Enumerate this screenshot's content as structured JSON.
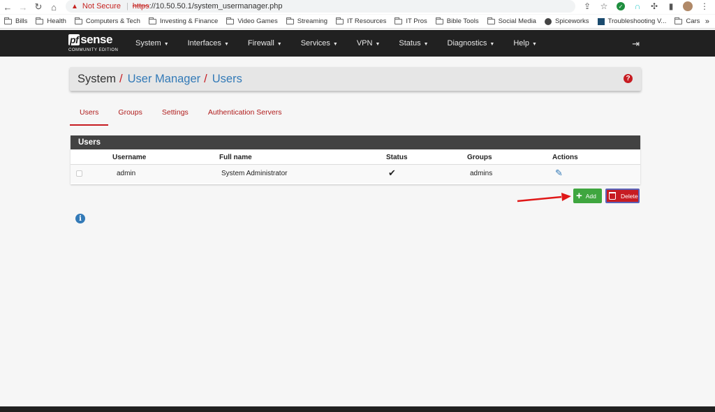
{
  "browser": {
    "not_secure": "Not Secure",
    "url_scheme": "https",
    "url_rest": "://10.50.50.1/system_usermanager.php",
    "bookmarks": [
      {
        "label": "Bills",
        "icon": "folder-icon"
      },
      {
        "label": "Health",
        "icon": "folder-icon"
      },
      {
        "label": "Computers & Tech",
        "icon": "folder-icon"
      },
      {
        "label": "Investing & Finance",
        "icon": "folder-icon"
      },
      {
        "label": "Video Games",
        "icon": "folder-icon"
      },
      {
        "label": "Streaming",
        "icon": "folder-icon"
      },
      {
        "label": "IT Resources",
        "icon": "folder-icon"
      },
      {
        "label": "IT Pros",
        "icon": "folder-icon"
      },
      {
        "label": "Bible Tools",
        "icon": "folder-icon"
      },
      {
        "label": "Social Media",
        "icon": "folder-icon"
      },
      {
        "label": "Spiceworks",
        "icon": "globe-icon"
      },
      {
        "label": "Troubleshooting V...",
        "icon": "site-icon"
      },
      {
        "label": "Cars",
        "icon": "folder-icon"
      }
    ],
    "more": "»"
  },
  "navbar": {
    "logo_pf": "pf",
    "logo_sense": "sense",
    "logo_edition": "COMMUNITY EDITION",
    "menu": [
      "System",
      "Interfaces",
      "Firewall",
      "Services",
      "VPN",
      "Status",
      "Diagnostics",
      "Help"
    ]
  },
  "breadcrumb": {
    "root": "System",
    "level1": "User Manager",
    "level2": "Users",
    "sep": "/"
  },
  "tabs": [
    "Users",
    "Groups",
    "Settings",
    "Authentication Servers"
  ],
  "users_panel": {
    "title": "Users",
    "columns": [
      "Username",
      "Full name",
      "Status",
      "Groups",
      "Actions"
    ],
    "rows": [
      {
        "username": "admin",
        "full_name": "System Administrator",
        "status": "✔",
        "groups": "admins"
      }
    ]
  },
  "buttons": {
    "add": "Add",
    "delete": "Delete"
  },
  "colors": {
    "accent_red": "#c71c22",
    "link_blue": "#337ab7",
    "add_green": "#3fa63f",
    "navbar": "#212121"
  }
}
